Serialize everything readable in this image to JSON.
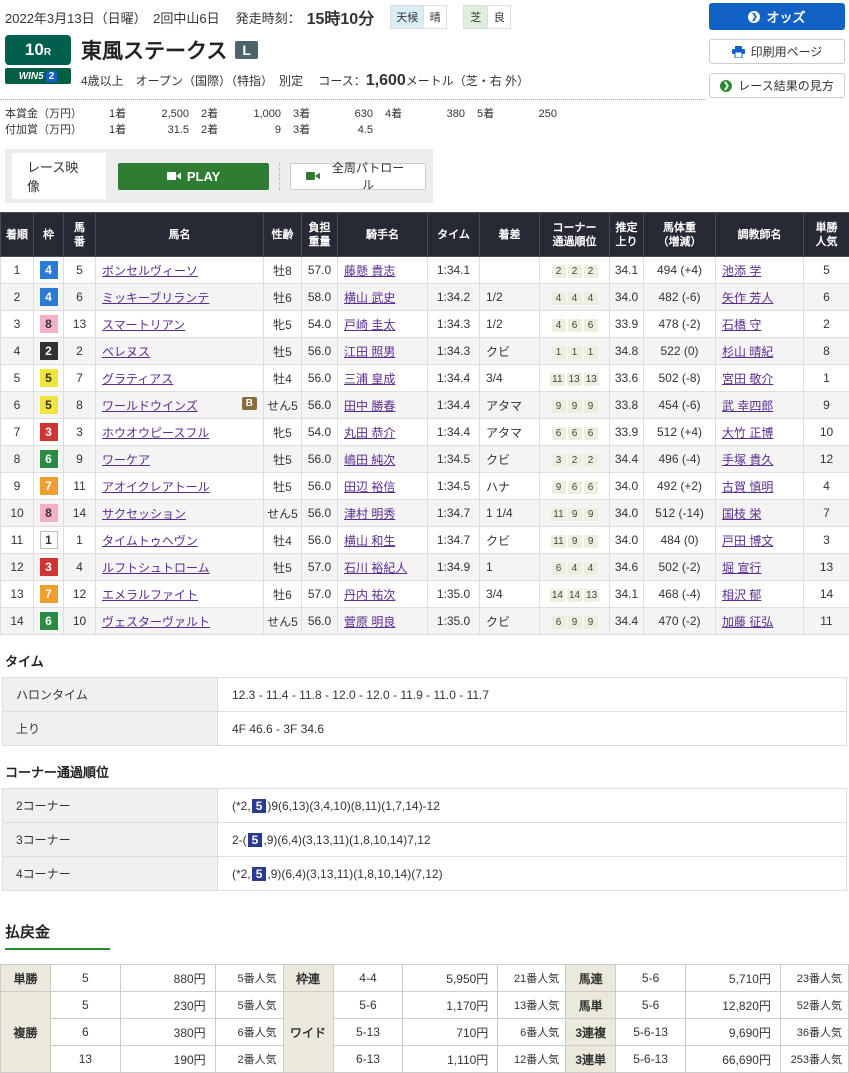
{
  "colors": {
    "accent_blue": "#1261c4",
    "accent_green": "#2e7d32",
    "header_bg": "#272a35",
    "link_purple": "#5b2d91",
    "highlight_navy": "#2b3a8f",
    "race_badge_green": "#00604d"
  },
  "header": {
    "date_line": "2022年3月13日（日曜）　2回中山6日",
    "start_label": "発走時刻：",
    "start_time": "15時10分",
    "weather_label": "天候",
    "weather_value": "晴",
    "turf_label": "芝",
    "turf_value": "良",
    "buttons": {
      "odds": "オッズ",
      "print": "印刷用ページ",
      "guide": "レース結果の見方"
    }
  },
  "race": {
    "number": "10",
    "number_suffix": "R",
    "win5": "WIN5",
    "win5_num": "2",
    "title": "東風ステークス",
    "grade": "L",
    "conditions": "4歳以上　オープン（国際）（特指）　別定",
    "course_label": "コース：",
    "course_value": "1,600",
    "course_unit": "メートル（芝・右 外）"
  },
  "prize": {
    "main_label": "本賞金（万円）",
    "main": [
      {
        "k": "1着",
        "v": "2,500"
      },
      {
        "k": "2着",
        "v": "1,000"
      },
      {
        "k": "3着",
        "v": "630"
      },
      {
        "k": "4着",
        "v": "380"
      },
      {
        "k": "5着",
        "v": "250"
      }
    ],
    "extra_label": "付加賞（万円）",
    "extra": [
      {
        "k": "1着",
        "v": "31.5"
      },
      {
        "k": "2着",
        "v": "9"
      },
      {
        "k": "3着",
        "v": "4.5"
      }
    ]
  },
  "video": {
    "label": "レース映像",
    "play": "PLAY",
    "patrol": "全周パトロール"
  },
  "results": {
    "headers": [
      "着順",
      "枠",
      "馬\n番",
      "馬名",
      "性齢",
      "負担\n重量",
      "騎手名",
      "タイム",
      "着差",
      "コーナー\n通過順位",
      "推定\n上り",
      "馬体重\n（増減）",
      "調教師名",
      "単勝\n人気"
    ],
    "rows": [
      {
        "pos": "1",
        "frame": "4",
        "num": "5",
        "name": "ボンセルヴィーソ",
        "badge": "",
        "sexage": "牡8",
        "weight": "57.0",
        "jockey": "藤懸 貴志",
        "time": "1:34.1",
        "margin": "",
        "corners": [
          "2",
          "2",
          "2"
        ],
        "last3f": "34.1",
        "body": "494 (+4)",
        "trainer": "池添 学",
        "pop": "5"
      },
      {
        "pos": "2",
        "frame": "4",
        "num": "6",
        "name": "ミッキーブリランテ",
        "badge": "",
        "sexage": "牡6",
        "weight": "58.0",
        "jockey": "横山 武史",
        "time": "1:34.2",
        "margin": "1/2",
        "corners": [
          "4",
          "4",
          "4"
        ],
        "last3f": "34.0",
        "body": "482 (-6)",
        "trainer": "矢作 芳人",
        "pop": "6"
      },
      {
        "pos": "3",
        "frame": "8",
        "num": "13",
        "name": "スマートリアン",
        "badge": "",
        "sexage": "牝5",
        "weight": "54.0",
        "jockey": "戸崎 圭太",
        "time": "1:34.3",
        "margin": "1/2",
        "corners": [
          "4",
          "6",
          "6"
        ],
        "last3f": "33.9",
        "body": "478 (-2)",
        "trainer": "石橋 守",
        "pop": "2"
      },
      {
        "pos": "4",
        "frame": "2",
        "num": "2",
        "name": "ベレヌス",
        "badge": "",
        "sexage": "牡5",
        "weight": "56.0",
        "jockey": "江田 照男",
        "time": "1:34.3",
        "margin": "クビ",
        "corners": [
          "1",
          "1",
          "1"
        ],
        "last3f": "34.8",
        "body": "522 (0)",
        "trainer": "杉山 晴紀",
        "pop": "8"
      },
      {
        "pos": "5",
        "frame": "5",
        "num": "7",
        "name": "グラティアス",
        "badge": "",
        "sexage": "牡4",
        "weight": "56.0",
        "jockey": "三浦 皇成",
        "time": "1:34.4",
        "margin": "3/4",
        "corners": [
          "11",
          "13",
          "13"
        ],
        "last3f": "33.6",
        "body": "502 (-8)",
        "trainer": "宮田 敬介",
        "pop": "1"
      },
      {
        "pos": "6",
        "frame": "5",
        "num": "8",
        "name": "ワールドウインズ",
        "badge": "B",
        "sexage": "せん5",
        "weight": "56.0",
        "jockey": "田中 勝春",
        "time": "1:34.4",
        "margin": "アタマ",
        "corners": [
          "9",
          "9",
          "9"
        ],
        "last3f": "33.8",
        "body": "454 (-6)",
        "trainer": "武 幸四郎",
        "pop": "9"
      },
      {
        "pos": "7",
        "frame": "3",
        "num": "3",
        "name": "ホウオウピースフル",
        "badge": "",
        "sexage": "牝5",
        "weight": "54.0",
        "jockey": "丸田 恭介",
        "time": "1:34.4",
        "margin": "アタマ",
        "corners": [
          "6",
          "6",
          "6"
        ],
        "last3f": "33.9",
        "body": "512 (+4)",
        "trainer": "大竹 正博",
        "pop": "10"
      },
      {
        "pos": "8",
        "frame": "6",
        "num": "9",
        "name": "ワーケア",
        "badge": "",
        "sexage": "牡5",
        "weight": "56.0",
        "jockey": "嶋田 純次",
        "time": "1:34.5",
        "margin": "クビ",
        "corners": [
          "3",
          "2",
          "2"
        ],
        "last3f": "34.4",
        "body": "496 (-4)",
        "trainer": "手塚 貴久",
        "pop": "12"
      },
      {
        "pos": "9",
        "frame": "7",
        "num": "11",
        "name": "アオイクレアトール",
        "badge": "",
        "sexage": "牡5",
        "weight": "56.0",
        "jockey": "田辺 裕信",
        "time": "1:34.5",
        "margin": "ハナ",
        "corners": [
          "9",
          "6",
          "6"
        ],
        "last3f": "34.0",
        "body": "492 (+2)",
        "trainer": "古賀 慎明",
        "pop": "4"
      },
      {
        "pos": "10",
        "frame": "8",
        "num": "14",
        "name": "サクセッション",
        "badge": "",
        "sexage": "せん5",
        "weight": "56.0",
        "jockey": "津村 明秀",
        "time": "1:34.7",
        "margin": "1 1/4",
        "corners": [
          "11",
          "9",
          "9"
        ],
        "last3f": "34.0",
        "body": "512 (-14)",
        "trainer": "国枝 栄",
        "pop": "7"
      },
      {
        "pos": "11",
        "frame": "1",
        "num": "1",
        "name": "タイムトゥヘヴン",
        "badge": "",
        "sexage": "牡4",
        "weight": "56.0",
        "jockey": "横山 和生",
        "time": "1:34.7",
        "margin": "クビ",
        "corners": [
          "11",
          "9",
          "9"
        ],
        "last3f": "34.0",
        "body": "484 (0)",
        "trainer": "戸田 博文",
        "pop": "3"
      },
      {
        "pos": "12",
        "frame": "3",
        "num": "4",
        "name": "ルフトシュトローム",
        "badge": "",
        "sexage": "牡5",
        "weight": "57.0",
        "jockey": "石川 裕紀人",
        "time": "1:34.9",
        "margin": "1",
        "corners": [
          "6",
          "4",
          "4"
        ],
        "last3f": "34.6",
        "body": "502 (-2)",
        "trainer": "堀 宣行",
        "pop": "13"
      },
      {
        "pos": "13",
        "frame": "7",
        "num": "12",
        "name": "エメラルファイト",
        "badge": "",
        "sexage": "牡6",
        "weight": "57.0",
        "jockey": "丹内 祐次",
        "time": "1:35.0",
        "margin": "3/4",
        "corners": [
          "14",
          "14",
          "13"
        ],
        "last3f": "34.1",
        "body": "468 (-4)",
        "trainer": "相沢 郁",
        "pop": "14"
      },
      {
        "pos": "14",
        "frame": "6",
        "num": "10",
        "name": "ヴェスターヴァルト",
        "badge": "",
        "sexage": "せん5",
        "weight": "56.0",
        "jockey": "菅原 明良",
        "time": "1:35.0",
        "margin": "クビ",
        "corners": [
          "6",
          "9",
          "9"
        ],
        "last3f": "34.4",
        "body": "470 (-2)",
        "trainer": "加藤 征弘",
        "pop": "11"
      }
    ]
  },
  "time_section": {
    "title": "タイム",
    "rows": [
      {
        "label": "ハロンタイム",
        "value": "12.3 - 11.4 - 11.8 - 12.0 - 12.0 - 11.9 - 11.0 - 11.7"
      },
      {
        "label": "上り",
        "value": "4F 46.6 - 3F 34.6"
      }
    ]
  },
  "corner_section": {
    "title": "コーナー通過順位",
    "rows": [
      {
        "label": "2コーナー",
        "pre": "(*2,",
        "hl": "5",
        "post": ")9(6,13)(3,4,10)(8,11)(1,7,14)-12"
      },
      {
        "label": "3コーナー",
        "pre": "2-(",
        "hl": "5",
        "post": ",9)(6,4)(3,13,11)(1,8,10,14)7,12"
      },
      {
        "label": "4コーナー",
        "pre": "(*2,",
        "hl": "5",
        "post": ",9)(6,4)(3,13,11)(1,8,10,14)(7,12)"
      }
    ]
  },
  "payout": {
    "title": "払戻金",
    "types": {
      "tansho": {
        "label": "単勝",
        "rows": [
          {
            "combo": "5",
            "amount": "880円",
            "pop": "5番人気"
          }
        ]
      },
      "fukusho": {
        "label": "複勝",
        "rows": [
          {
            "combo": "5",
            "amount": "230円",
            "pop": "5番人気"
          },
          {
            "combo": "6",
            "amount": "380円",
            "pop": "6番人気"
          },
          {
            "combo": "13",
            "amount": "190円",
            "pop": "2番人気"
          }
        ]
      },
      "wakuren": {
        "label": "枠連",
        "rows": [
          {
            "combo": "4-4",
            "amount": "5,950円",
            "pop": "21番人気"
          }
        ]
      },
      "wide": {
        "label": "ワイド",
        "rows": [
          {
            "combo": "5-6",
            "amount": "1,170円",
            "pop": "13番人気"
          },
          {
            "combo": "5-13",
            "amount": "710円",
            "pop": "6番人気"
          },
          {
            "combo": "6-13",
            "amount": "1,110円",
            "pop": "12番人気"
          }
        ]
      },
      "umaren": {
        "label": "馬連",
        "rows": [
          {
            "combo": "5-6",
            "amount": "5,710円",
            "pop": "23番人気"
          }
        ]
      },
      "umatan": {
        "label": "馬単",
        "rows": [
          {
            "combo": "5-6",
            "amount": "12,820円",
            "pop": "52番人気"
          }
        ]
      },
      "sanrenpuku": {
        "label": "3連複",
        "rows": [
          {
            "combo": "5-6-13",
            "amount": "9,690円",
            "pop": "36番人気"
          }
        ]
      },
      "sanrentan": {
        "label": "3連単",
        "rows": [
          {
            "combo": "5-6-13",
            "amount": "66,690円",
            "pop": "253番人気"
          }
        ]
      }
    }
  }
}
